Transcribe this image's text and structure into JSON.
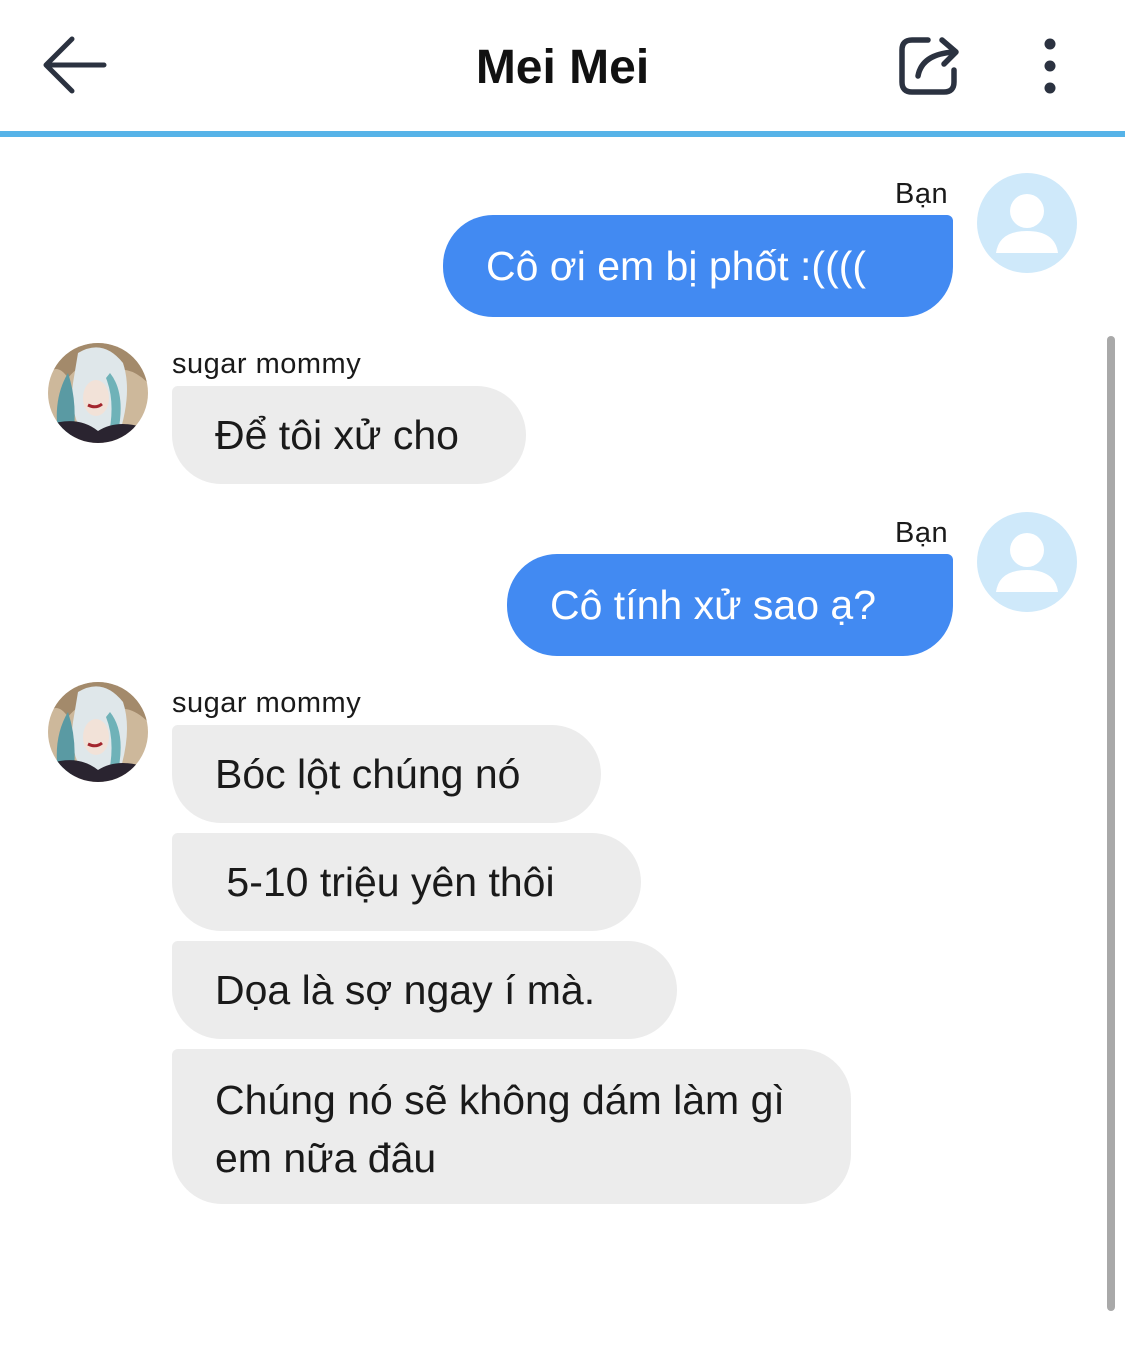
{
  "header": {
    "title": "Mei Mei",
    "back_icon": "back-arrow-icon",
    "share_icon": "share-icon",
    "more_icon": "more-vertical-icon",
    "accent_color": "#56b3e8"
  },
  "colors": {
    "outgoing_bubble": "#428af2",
    "incoming_bubble": "#ececec",
    "user_avatar_bg": "#cfe9fa"
  },
  "messages": [
    {
      "sender": "Bạn",
      "text": "Cô ơi em bị phốt :(((("
    },
    {
      "sender": "sugar mommy",
      "text": "Để tôi xử cho"
    },
    {
      "sender": "Bạn",
      "text": "Cô tính xử sao ạ?"
    },
    {
      "sender": "sugar mommy",
      "text": "Bóc lột chúng nó"
    },
    {
      "text": " 5-10 triệu yên thôi"
    },
    {
      "text": "Dọa là sợ ngay í mà."
    },
    {
      "text": "Chúng nó sẽ không dám làm gì em nữa đâu"
    }
  ]
}
